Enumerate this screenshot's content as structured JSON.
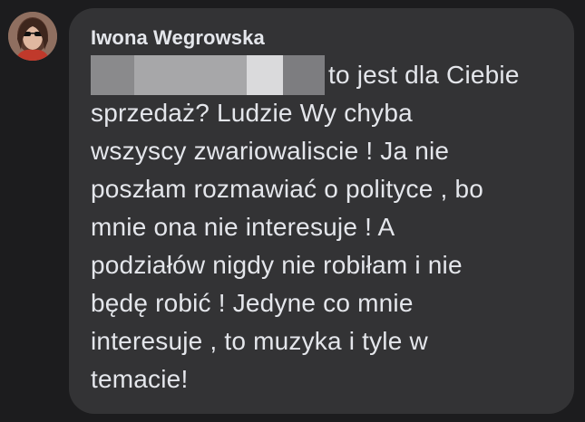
{
  "comment": {
    "author": "Iwona Wegrowska",
    "first_line_visible": "to jest dla Ciebie",
    "lines": [
      "sprzedaż?  Ludzie Wy chyba",
      "wszyscy zwariowaliscie ! Ja nie",
      "poszłam rozmawiać o polityce , bo",
      "mnie ona nie interesuje ! A",
      "podziałów nigdy nie robiłam i nie",
      "będę robić ! Jedyne co mnie",
      "interesuje , to muzyka i tyle w",
      "temacie!"
    ]
  },
  "colors": {
    "page_bg": "#1c1c1e",
    "bubble_bg": "#333335",
    "text": "#e4e6eb"
  }
}
